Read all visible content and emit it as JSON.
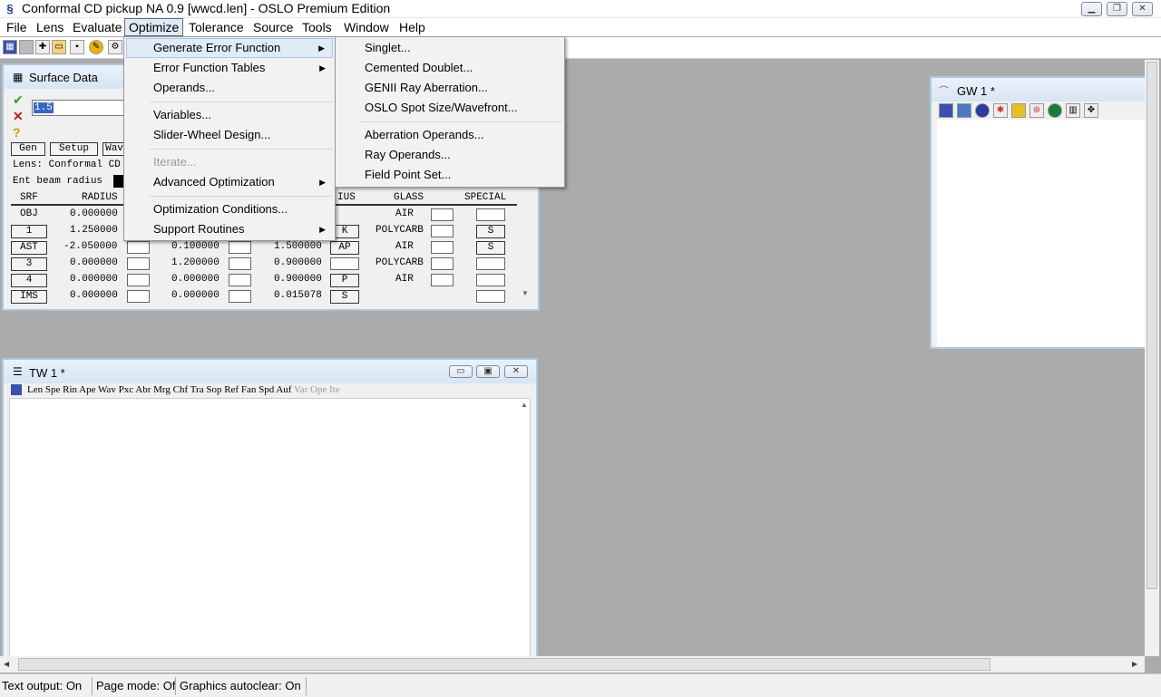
{
  "window": {
    "title": "Conformal CD pickup NA 0.9 [wwcd.len] - OSLO Premium Edition"
  },
  "menubar": [
    "File",
    "Lens",
    "Evaluate",
    "Optimize",
    "Tolerance",
    "Source",
    "Tools",
    "Window",
    "Help"
  ],
  "optimize_menu": {
    "items": [
      "Generate Error Function",
      "Error Function Tables",
      "Operands...",
      "Variables...",
      "Slider-Wheel Design...",
      "Iterate...",
      "Advanced Optimization",
      "Optimization Conditions...",
      "Support Routines"
    ]
  },
  "submenu": {
    "items": [
      "Singlet...",
      "Cemented Doublet...",
      "GENII Ray Aberration...",
      "OSLO Spot Size/Wavefront...",
      "Aberration Operands...",
      "Ray Operands...",
      "Field Point Set..."
    ]
  },
  "surface_data": {
    "title": "Surface Data",
    "input_value": "1.5",
    "buttons": [
      "Gen",
      "Setup",
      "Wav"
    ],
    "lens_line": "Lens: Conformal CD",
    "ebr_label": "Ent beam radius",
    "headers": {
      "srf": "SRF",
      "radius": "RADIUS",
      "aperture": "IUS",
      "glass": "GLASS",
      "special": "SPECIAL"
    },
    "rows": [
      {
        "srf": "OBJ",
        "radius": "0.000000",
        "thickness": "",
        "aperture": "",
        "ap_flag": "",
        "glass": "AIR",
        "special": ""
      },
      {
        "srf": "1",
        "radius": "1.250000",
        "thickness": "",
        "aperture": "",
        "ap_flag": "K",
        "glass": "POLYCARB",
        "special": "S"
      },
      {
        "srf": "AST",
        "radius": "-2.050000",
        "thickness": "0.100000",
        "aperture": "1.500000",
        "ap_flag": "AP",
        "glass": "AIR",
        "special": "S"
      },
      {
        "srf": "3",
        "radius": "0.000000",
        "thickness": "1.200000",
        "aperture": "0.900000",
        "ap_flag": "",
        "glass": "POLYCARB",
        "special": ""
      },
      {
        "srf": "4",
        "radius": "0.000000",
        "thickness": "0.000000",
        "aperture": "0.900000",
        "ap_flag": "P",
        "glass": "AIR",
        "special": ""
      },
      {
        "srf": "IMS",
        "radius": "0.000000",
        "thickness": "0.000000",
        "aperture": "0.015078",
        "ap_flag": "S",
        "glass": "",
        "special": ""
      }
    ]
  },
  "text_window": {
    "title": "TW 1 *",
    "toolbar_active": "Len Spe Rin Ape Wav Pxc Abr Mrg Chf Tra Sop Ref Fan Spd Auf",
    "toolbar_disabled": "Var Ope Ite"
  },
  "graphics_window": {
    "title": "GW 1 *"
  },
  "statusbar": [
    "Text output: On",
    "Page mode: Off",
    "Graphics autoclear: On"
  ]
}
